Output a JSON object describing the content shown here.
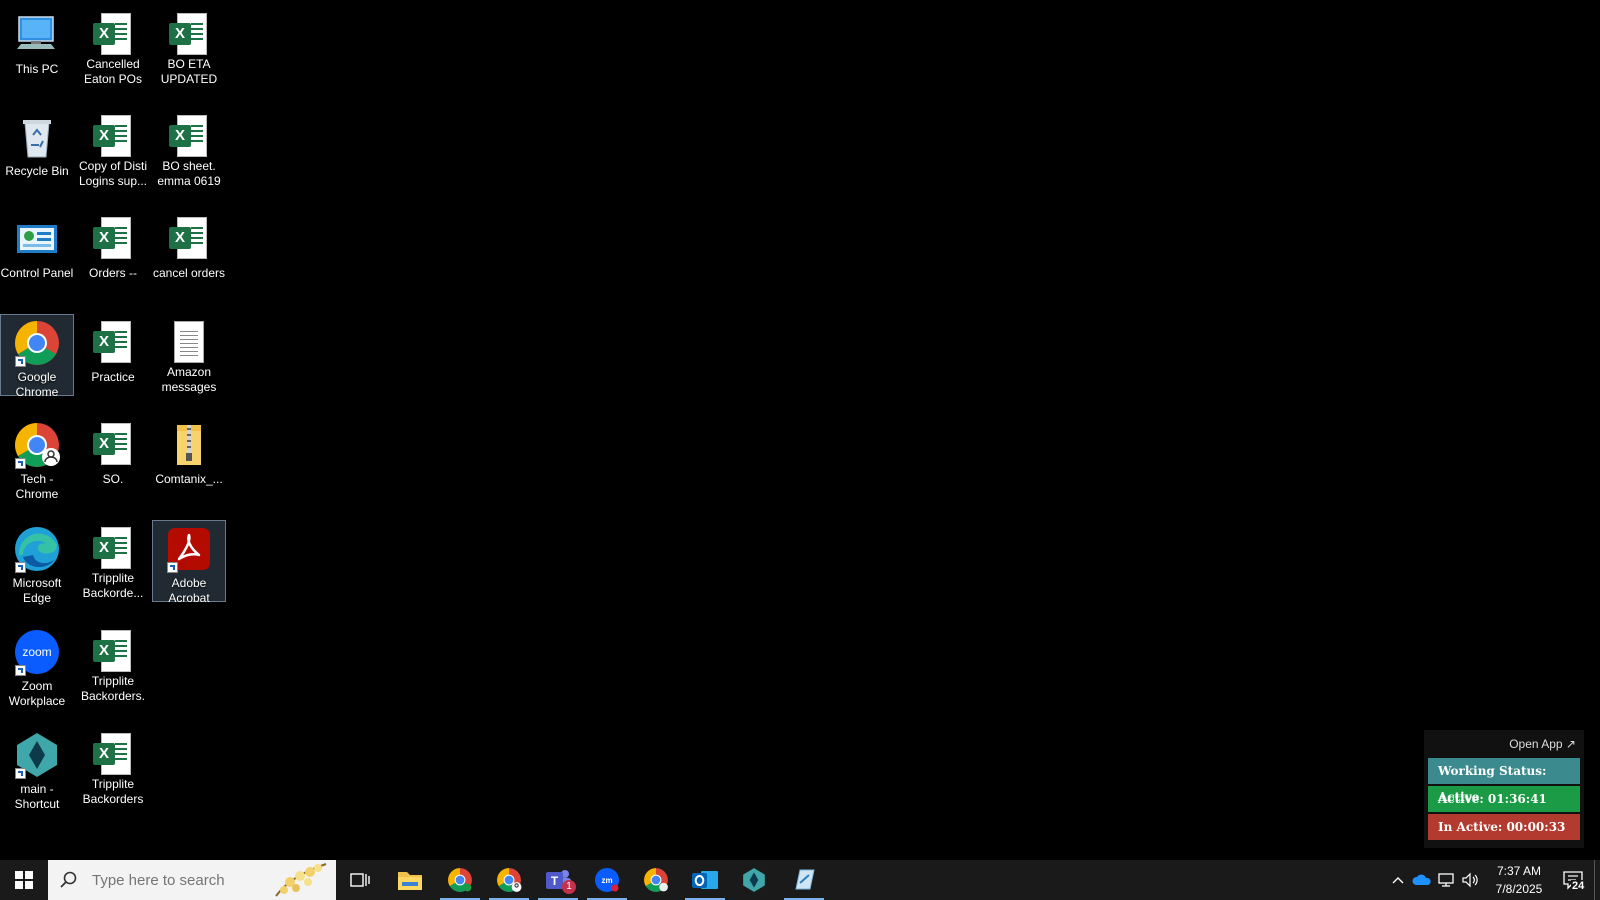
{
  "desktop": {
    "icons": [
      {
        "label": "This PC"
      },
      {
        "label": "Cancelled Eaton POs"
      },
      {
        "label": "BO ETA UPDATED"
      },
      {
        "label": "Recycle Bin"
      },
      {
        "label": "Copy of Disti Logins sup..."
      },
      {
        "label": "BO sheet. emma 0619"
      },
      {
        "label": "Control Panel"
      },
      {
        "label": "Orders --"
      },
      {
        "label": "cancel orders"
      },
      {
        "label": "Google Chrome"
      },
      {
        "label": "Practice"
      },
      {
        "label": "Amazon messages"
      },
      {
        "label": "Tech - Chrome"
      },
      {
        "label": "SO."
      },
      {
        "label": "Comtanix_..."
      },
      {
        "label": "Microsoft Edge"
      },
      {
        "label": "Tripplite Backorde..."
      },
      {
        "label": "Adobe Acrobat"
      },
      {
        "label": "Zoom Workplace"
      },
      {
        "label": "Tripplite Backorders."
      },
      {
        "label": "main - Shortcut"
      },
      {
        "label": "Tripplite Backorders"
      }
    ]
  },
  "widget": {
    "open_app": "Open App ↗",
    "status": "Working Status: Active",
    "active": "Active: 01:36:41",
    "inactive": "In Active: 00:00:33",
    "colors": {
      "status": "#3b8a8e",
      "active": "#1c9b46",
      "inactive": "#b23a2e"
    }
  },
  "taskbar": {
    "search_placeholder": "Type here to search",
    "teams_badge": "1",
    "time": "7:37 AM",
    "date": "7/8/2025",
    "notification_count": "24"
  }
}
